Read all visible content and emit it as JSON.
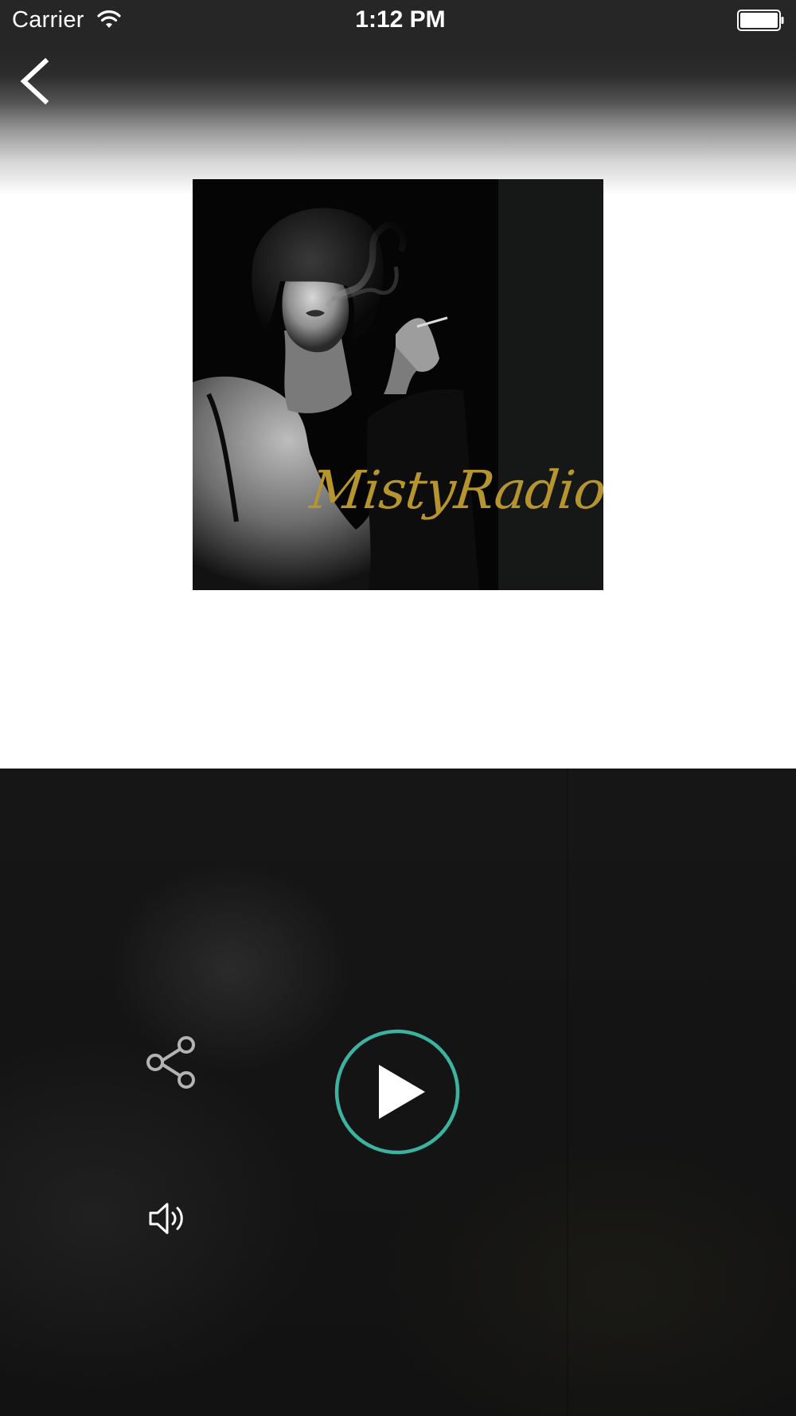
{
  "status_bar": {
    "carrier": "Carrier",
    "time": "1:12 PM",
    "wifi_icon": "wifi-icon",
    "battery_icon": "battery-full-icon"
  },
  "navigation": {
    "back_icon": "chevron-left-icon"
  },
  "artwork": {
    "logo_text": "MistyRadio",
    "logo_color": "#b6952f",
    "description_icon": "album-art-image"
  },
  "player": {
    "play_icon": "play-icon",
    "play_ring_color": "#3bb3a0",
    "share_icon": "share-icon",
    "volume_icon": "speaker-volume-icon"
  },
  "colors": {
    "panel_background": "#141414",
    "header_dark": "#262626"
  }
}
